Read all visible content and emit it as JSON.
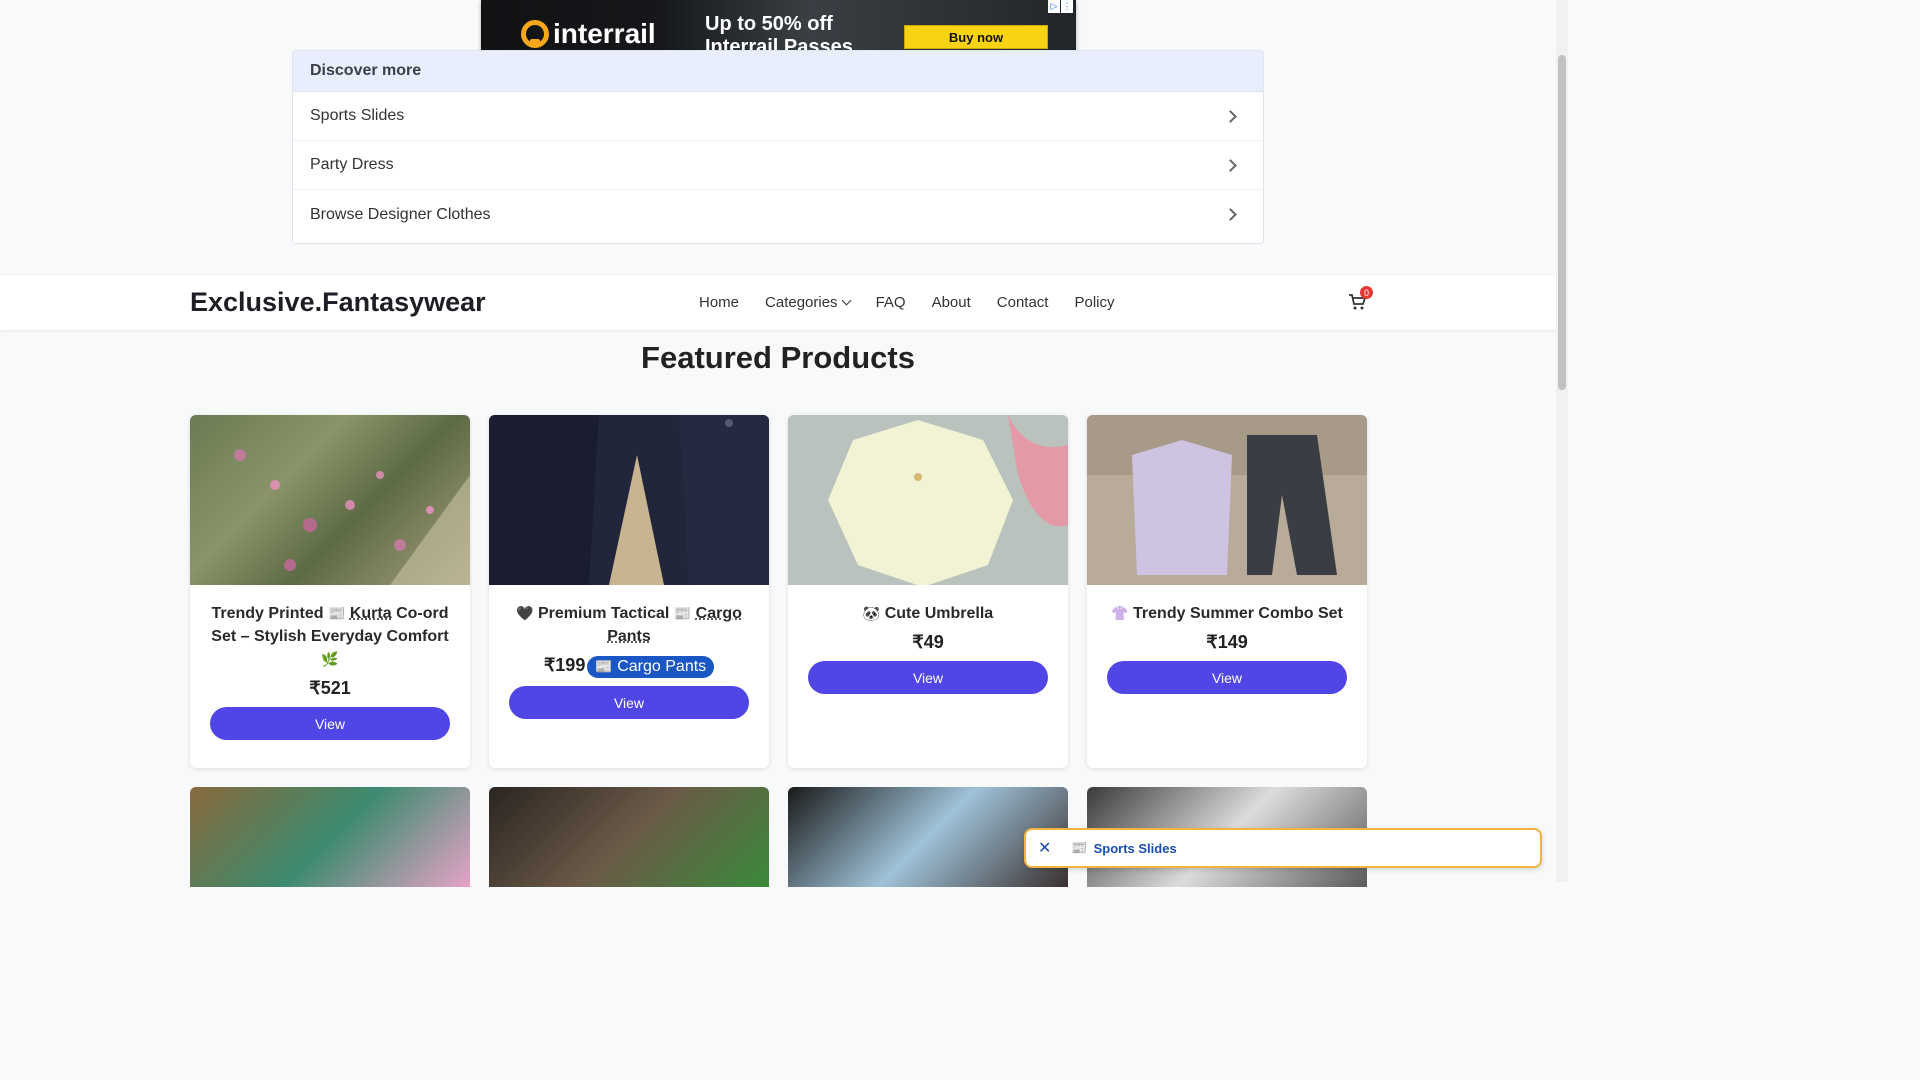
{
  "ad": {
    "brand": "interrail",
    "headline_line1": "Up to 50% off",
    "headline_line2": "Interrail Passes",
    "cta": "Buy now"
  },
  "discover": {
    "title": "Discover more",
    "items": [
      {
        "label": "Sports Slides"
      },
      {
        "label": "Party Dress"
      },
      {
        "label": "Browse Designer Clothes"
      }
    ]
  },
  "navbar": {
    "brand": "Exclusive.Fantasywear",
    "links": [
      "Home",
      "Categories",
      "FAQ",
      "About",
      "Contact",
      "Policy"
    ],
    "cart_count": "0"
  },
  "featured": {
    "title": "Featured Products",
    "products": [
      {
        "emoji": "",
        "title_a": "Trendy Printed ",
        "keyword": "Kurta",
        "title_b": " Co-ord Set – Stylish Everyday Comfort",
        "trailing_emoji": "🌿",
        "price": "₹521",
        "button": "View"
      },
      {
        "emoji": "🖤",
        "title_a": "Premium Tactical ",
        "keyword": "Cargo Pants",
        "title_b": "",
        "trailing_emoji": "",
        "price": "₹199",
        "tag": "Cargo Pants",
        "button": "View"
      },
      {
        "emoji": "🐼",
        "title_a": "Cute Umbrella",
        "keyword": "",
        "title_b": "",
        "trailing_emoji": "",
        "price": "₹49",
        "button": "View"
      },
      {
        "emoji": "👚",
        "title_a": "Trendy Summer Combo Set",
        "keyword": "",
        "title_b": "",
        "trailing_emoji": "",
        "price": "₹149",
        "button": "View"
      }
    ]
  },
  "popup": {
    "label": "Sports Slides"
  },
  "colors": {
    "accent": "#4f46e5",
    "ad_button": "#f8d313",
    "badge": "#e53935"
  }
}
